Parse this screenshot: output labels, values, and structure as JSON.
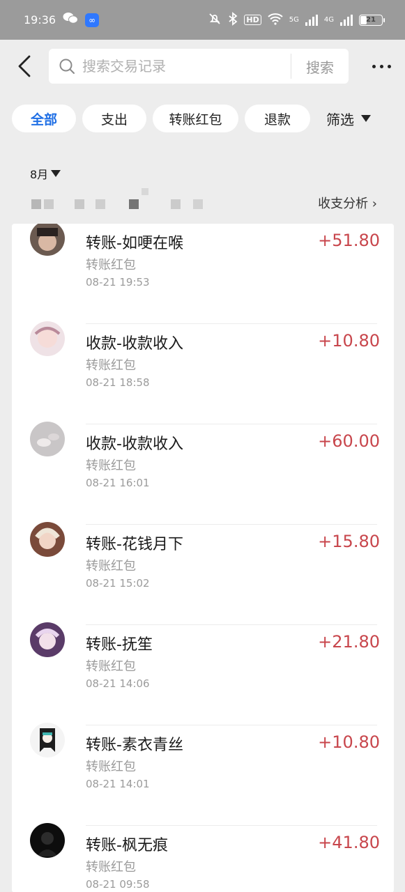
{
  "status_bar": {
    "time": "19:36",
    "hd": "HD",
    "net1": "5G",
    "net2": "4G",
    "battery": "21",
    "app_icons": [
      "wechat-icon",
      "infinity-app-icon"
    ]
  },
  "header": {
    "search_placeholder": "搜索交易记录",
    "search_button": "搜索"
  },
  "tabs": [
    {
      "label": "全部",
      "active": true
    },
    {
      "label": "支出",
      "active": false
    },
    {
      "label": "转账红包",
      "active": false
    },
    {
      "label": "退款",
      "active": false
    }
  ],
  "filter_label": "筛选",
  "month_label": "8月",
  "analysis_label": "收支分析 ›",
  "colors": {
    "accent": "#1f6fe5",
    "income": "#c8464c",
    "status_bar": "#9b9b9b"
  },
  "transactions": [
    {
      "title": "转账-如哽在喉",
      "category": "转账红包",
      "time": "08-21 19:53",
      "amount": "+51.80",
      "avatar": "avatar-dark-hair"
    },
    {
      "title": "收款-收款收入",
      "category": "转账红包",
      "time": "08-21 18:58",
      "amount": "+10.80",
      "avatar": "avatar-pink-anime"
    },
    {
      "title": "收款-收款收入",
      "category": "转账红包",
      "time": "08-21 16:01",
      "amount": "+60.00",
      "avatar": "avatar-grey-photo"
    },
    {
      "title": "转账-花钱月下",
      "category": "转账红包",
      "time": "08-21 15:02",
      "amount": "+15.80",
      "avatar": "avatar-blonde-girl"
    },
    {
      "title": "转账-抚笙",
      "category": "转账红包",
      "time": "08-21 14:06",
      "amount": "+21.80",
      "avatar": "avatar-purple-anime"
    },
    {
      "title": "转账-素衣青丝",
      "category": "转账红包",
      "time": "08-21 14:01",
      "amount": "+10.80",
      "avatar": "avatar-teal-anime"
    },
    {
      "title": "转账-枫无痕",
      "category": "转账红包",
      "time": "08-21 09:58",
      "amount": "+41.80",
      "avatar": "avatar-black-figure"
    }
  ]
}
